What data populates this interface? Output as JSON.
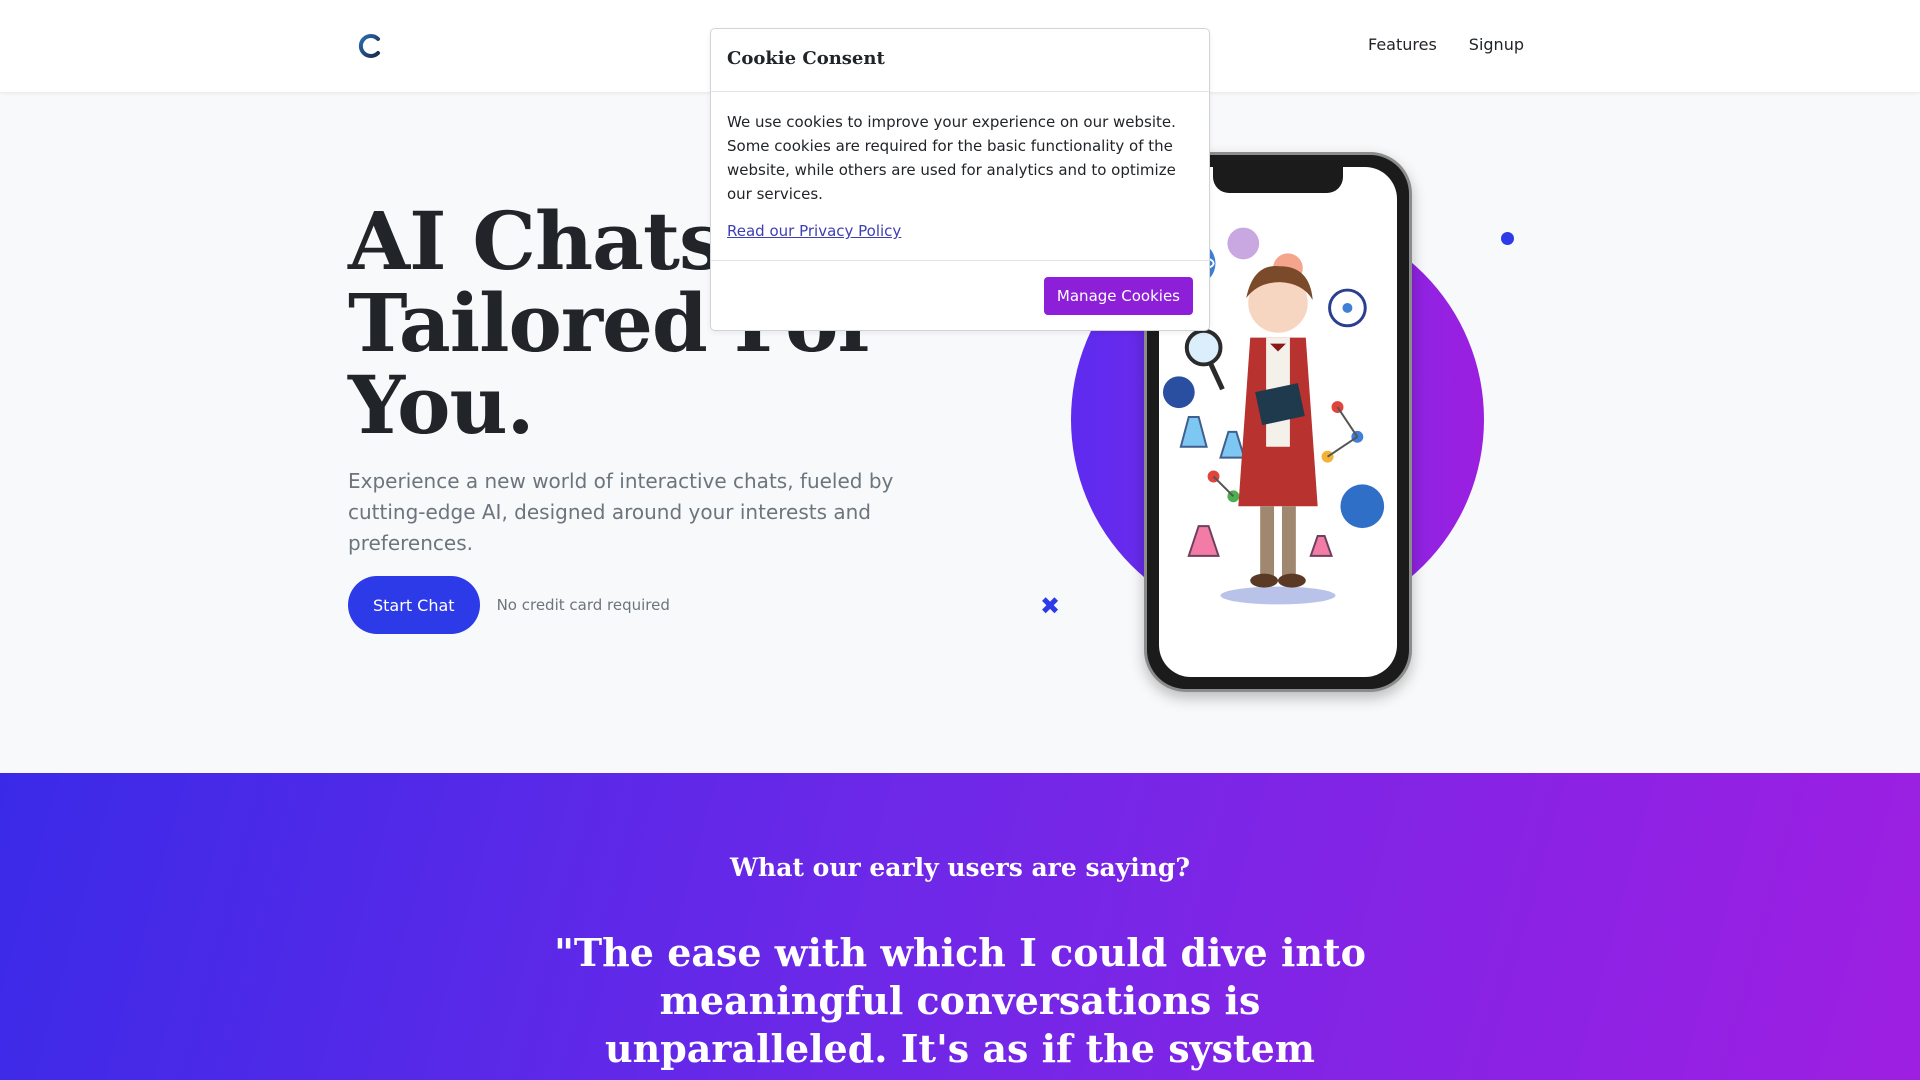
{
  "header": {
    "logo_icon": "c-logo-icon",
    "nav": [
      {
        "label": "Features"
      },
      {
        "label": "Signup"
      }
    ]
  },
  "hero": {
    "title": "AI Chats Tailored For You.",
    "subtitle": "Experience a new world of interactive chats, fueled by cutting-edge AI, designed around your interests and preferences.",
    "cta_label": "Start Chat",
    "cta_note": "No credit card required"
  },
  "decor": {
    "x_glyph": "✖",
    "accent": "#2d3ae8",
    "purple": "#8e1fd8"
  },
  "testimonials": {
    "heading": "What our early users are saying?",
    "quote": "\"The ease with which I could dive into meaningful conversations is unparalleled. It's as if the system knows exactly what I'm"
  },
  "cookie_modal": {
    "title": "Cookie Consent",
    "body": "We use cookies to improve your experience on our website. Some cookies are required for the basic functionality of the website, while others are used for analytics and to optimize our services.",
    "privacy_link": "Read our Privacy Policy",
    "manage_label": "Manage Cookies"
  }
}
